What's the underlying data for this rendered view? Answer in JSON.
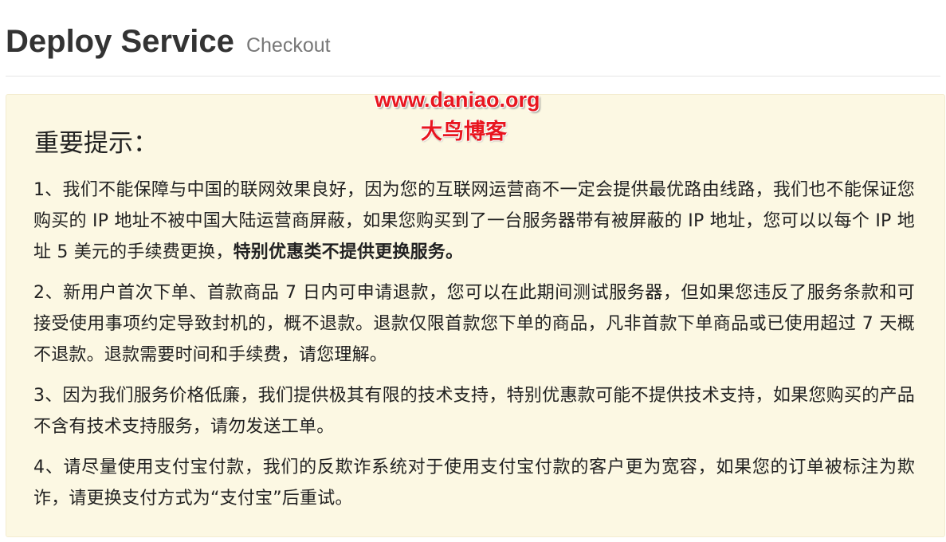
{
  "header": {
    "title": "Deploy Service",
    "subtitle": "Checkout"
  },
  "watermark": {
    "url": "www.daniao.org",
    "name": "大鸟博客"
  },
  "notice": {
    "title": "重要提示：",
    "items": [
      {
        "text": "1、我们不能保障与中国的联网效果良好，因为您的互联网运营商不一定会提供最优路由线路，我们也不能保证您购买的 IP 地址不被中国大陆运营商屏蔽，如果您购买到了一台服务器带有被屏蔽的 IP 地址，您可以以每个 IP 地址 5 美元的手续费更换，",
        "bold": "特别优惠类不提供更换服务。"
      },
      {
        "text": "2、新用户首次下单、首款商品 7 日内可申请退款，您可以在此期间测试服务器，但如果您违反了服务条款和可接受使用事项约定导致封机的，概不退款。退款仅限首款您下单的商品，凡非首款下单商品或已使用超过 7 天概不退款。退款需要时间和手续费，请您理解。",
        "bold": ""
      },
      {
        "text": "3、因为我们服务价格低廉，我们提供极其有限的技术支持，特别优惠款可能不提供技术支持，如果您购买的产品不含有技术支持服务，请勿发送工单。",
        "bold": ""
      },
      {
        "text": "4、请尽量使用支付宝付款，我们的反欺诈系统对于使用支付宝付款的客户更为宽容，如果您的订单被标注为欺诈，请更换支付方式为“支付宝”后重试。",
        "bold": ""
      }
    ]
  },
  "colors": {
    "notice_bg": "#fcf8e3",
    "watermark": "#e8161f",
    "heading": "#333333"
  }
}
